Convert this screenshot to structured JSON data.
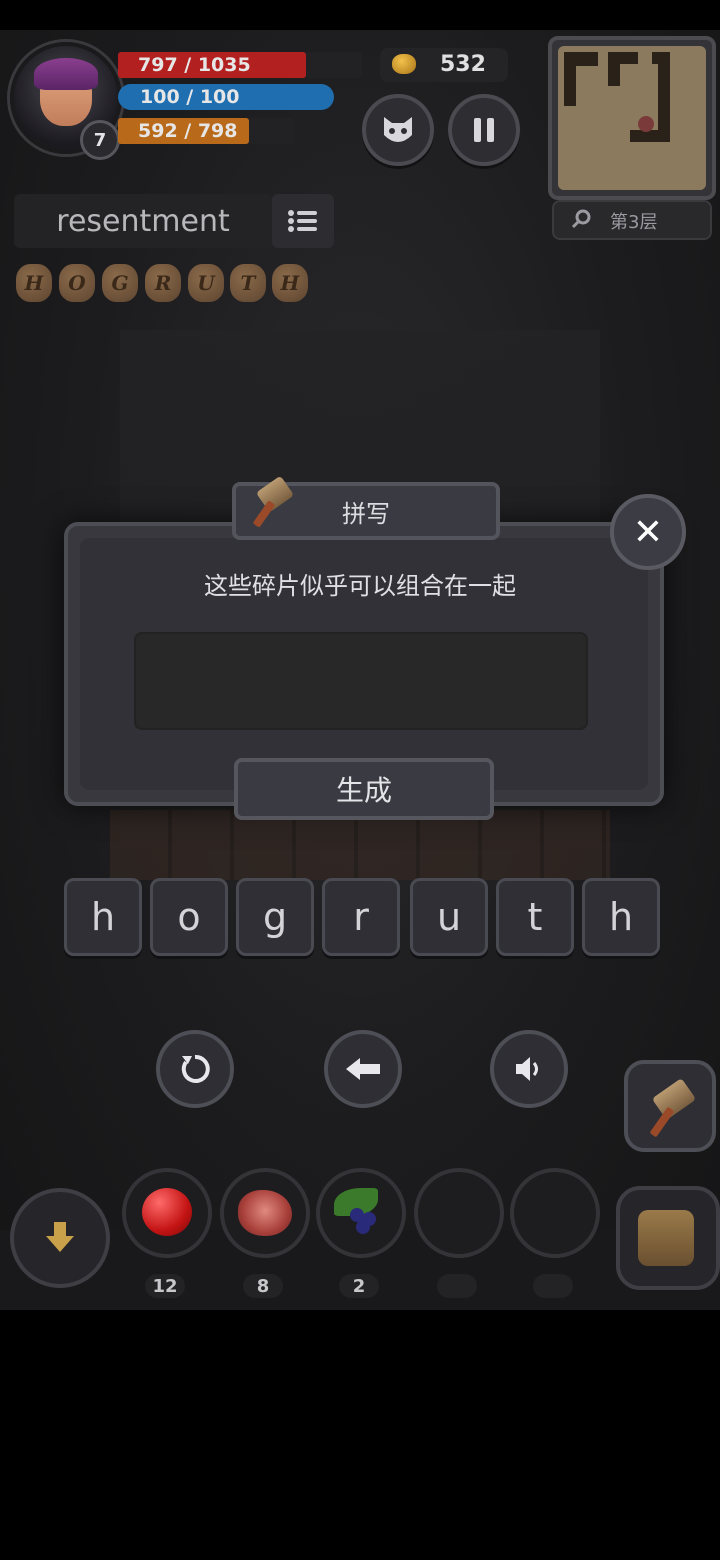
{
  "hud": {
    "hp": {
      "text": "797 / 1035",
      "current": 797,
      "max": 1035,
      "color": "#b32020"
    },
    "mp": {
      "text": "100 / 100",
      "current": 100,
      "max": 100,
      "color": "#1f6fb0"
    },
    "xp": {
      "text": "592 / 798",
      "current": 592,
      "max": 798,
      "color": "#b86a1a"
    },
    "level": "7",
    "gold": "532",
    "floor": "第3层"
  },
  "word_panel": {
    "word": "resentment",
    "fragments": [
      "H",
      "O",
      "G",
      "R",
      "U",
      "T",
      "H"
    ]
  },
  "dialog": {
    "title": "拼写",
    "prompt": "这些碎片似乎可以组合在一起",
    "answer_value": "",
    "generate_label": "生成"
  },
  "letters": [
    "h",
    "o",
    "g",
    "r",
    "u",
    "t",
    "h"
  ],
  "inventory": [
    {
      "icon": "apple-icon",
      "count": "12"
    },
    {
      "icon": "meat-icon",
      "count": "8"
    },
    {
      "icon": "berry-icon",
      "count": "2"
    },
    {
      "icon": "",
      "count": ""
    },
    {
      "icon": "",
      "count": ""
    }
  ]
}
